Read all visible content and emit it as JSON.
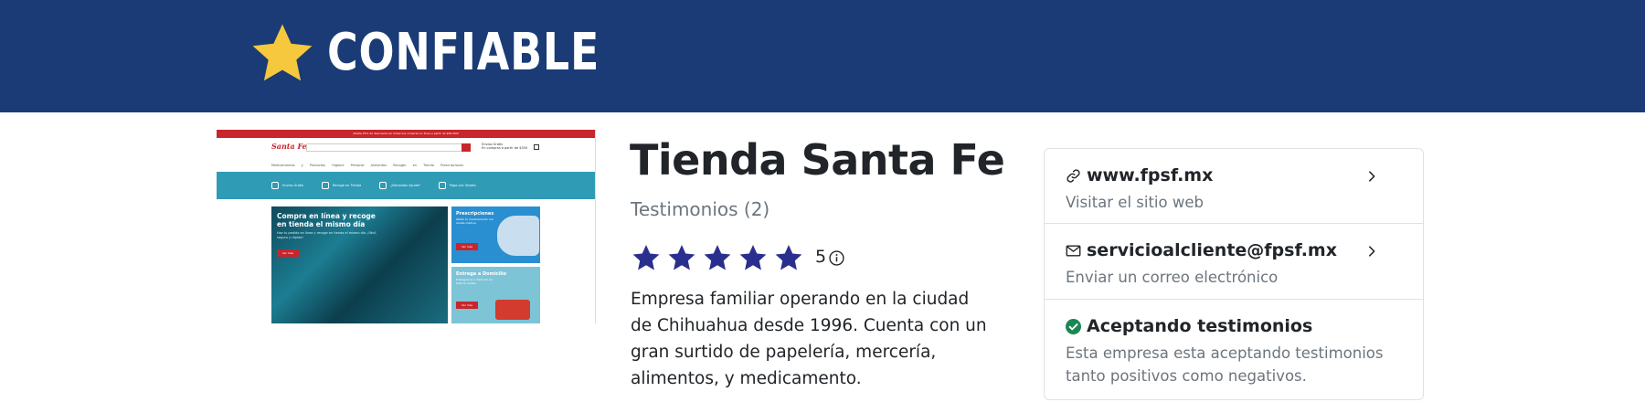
{
  "header": {
    "brand": "CONFIABLE",
    "bg_color": "#1a3b76",
    "star_color": "#f5c83d"
  },
  "thumbnail": {
    "topbar": "¡Hasta 15% de descuento en todas tus compras en línea a partir de $30,000!",
    "logo": "Santa Fe",
    "info_title": "Envíos Gratis",
    "info_sub": "En compras a partir de $300",
    "menu": "Medicamentos y Productos  Higiene Personal  Alimentos  Recoger en Tienda  Prescripciones",
    "band": [
      {
        "label": "Envíos Gratis"
      },
      {
        "label": "Recoge en Tienda"
      },
      {
        "label": "¿Necesitas Ayuda?"
      },
      {
        "label": "Pago con Tarjeta"
      }
    ],
    "hero_title": "Compra en línea y recoge en tienda el mismo día",
    "hero_sub": "Haz tu pedido en línea y recoge en tienda el mismo día. ¡Fácil, seguro y rápido!",
    "hero_button": "Ver más",
    "card1_title": "Prescripciones",
    "card1_sub": "Obtén tu medicamento con receta médica.",
    "card1_button": "Ver más",
    "card2_title": "Entrega a Domicilio",
    "card2_sub": "Entregamos a domicilio en toda la ciudad.",
    "card2_button": "Ver más"
  },
  "business": {
    "name": "Tienda Santa Fe",
    "reviews_link": "Testimonios (2)",
    "rating": "5",
    "rating_stars": 5,
    "star_color": "#2a2f8f",
    "description": "Empresa familiar operando en la ciudad de Chihuahua desde 1996. Cuenta con un gran surtido de papelería, mercería, alimentos, y medicamento."
  },
  "contact_card": {
    "website": {
      "title": "www.fpsf.mx",
      "subtitle": "Visitar el sitio web",
      "icon": "link-icon"
    },
    "email": {
      "title": "servicioalcliente@fpsf.mx",
      "subtitle": "Enviar un correo electrónico",
      "icon": "envelope-icon"
    },
    "status": {
      "title": "Aceptando testimonios",
      "subtitle": "Esta empresa esta aceptando testimonios tanto positivos como negativos.",
      "icon": "check-circle-icon",
      "color": "#198754"
    }
  }
}
